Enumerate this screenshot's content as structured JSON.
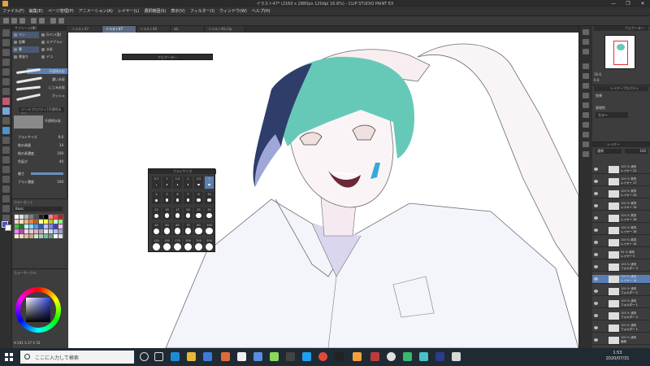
{
  "window": {
    "title": "イラスト47* (2160 x 2880px 120dpi 16.6%) - CLIP STUDIO PAINT EX",
    "minimize": "—",
    "maximize": "❐",
    "close": "✕"
  },
  "menu": [
    "ファイル(F)",
    "編集(E)",
    "ページ管理(P)",
    "アニメーション(A)",
    "レイヤー(L)",
    "選択範囲(S)",
    "表示(V)",
    "フィルター(I)",
    "ウィンドウ(W)",
    "ヘルプ(H)"
  ],
  "tabs": [
    "イラスト47",
    "イラスト47",
    "イラスト48",
    "ab",
    "イラスト46.clip"
  ],
  "subtool": {
    "header": "サブツール[筆]",
    "tabs": [
      "ペン",
      "Gペン(滑)",
      "鉛筆",
      "エアブラシ",
      "筆",
      "水彩",
      "厚塗り",
      "デコ"
    ],
    "brushes": [
      "不透明水彩",
      "濃い水彩",
      "にじみ水彩",
      "ガッシュ"
    ],
    "selected_label": "ツールプロパティ[不透明水彩]"
  },
  "toolprop": {
    "header": "不透明水彩",
    "rows": [
      {
        "label": "ブラシサイズ",
        "value": "9.0"
      },
      {
        "label": "絵の具量",
        "value": "34"
      },
      {
        "label": "絵の具濃度",
        "value": "100"
      },
      {
        "label": "色延び",
        "value": "40"
      },
      {
        "label": "硬さ",
        "value": ""
      },
      {
        "label": "ブラシ濃度",
        "value": "100"
      }
    ]
  },
  "colorset": {
    "header": "カラーセット",
    "name": "Basic"
  },
  "colorwheel": {
    "header": "カラーサークル",
    "h": "241",
    "s": "37",
    "v": "52"
  },
  "navigator_float": {
    "title": "ナビゲーター"
  },
  "brushsize": {
    "title": "ブラシサイズ",
    "sizes": [
      "0.7",
      "1",
      "1.5",
      "2",
      "2.5",
      "3",
      "4",
      "5",
      "6",
      "7",
      "8",
      "10",
      "12",
      "15",
      "17",
      "20",
      "25",
      "30",
      "40",
      "50",
      "60",
      "70",
      "80",
      "100",
      "120",
      "150",
      "170",
      "200",
      "250",
      "300"
    ],
    "selected": "3"
  },
  "rightpanels": {
    "navigator": "ナビゲーター",
    "navigator_zoom": "16.6",
    "navigator_angle": "0.0",
    "layer_property_header": "レイヤープロパティ",
    "layer_property_effect": "効果",
    "layer_property_mode_label": "表現色",
    "layer_property_mode": "カラー",
    "layer_header": "レイヤー",
    "blend": "通常",
    "opacity": "100"
  },
  "layers": [
    {
      "mode": "100 % 通常",
      "name": "レイヤー 21"
    },
    {
      "mode": "100 % 乗算",
      "name": "レイヤー 17"
    },
    {
      "mode": "100 % 乗算",
      "name": "レイヤー 20"
    },
    {
      "mode": "100 % 乗算",
      "name": "レイヤー 19"
    },
    {
      "mode": "100 % 乗算",
      "name": "レイヤー 18"
    },
    {
      "mode": "100 % 乗算",
      "name": "レイヤー 16"
    },
    {
      "mode": "100 % 乗算",
      "name": "レイヤー 15"
    },
    {
      "mode": "94 % 通常",
      "name": "レイヤー 5"
    },
    {
      "mode": "100 % 通常",
      "name": "フォルダー 3"
    },
    {
      "mode": "100 % 通常",
      "name": "レイヤー 14"
    },
    {
      "mode": "100 % 通常",
      "name": "フォルダー 2"
    },
    {
      "mode": "100 % 通常",
      "name": "フォルダー 1"
    },
    {
      "mode": "100 % 通常",
      "name": "フォルダー 4"
    },
    {
      "mode": "100 % 通常",
      "name": "フォルダー 1"
    },
    {
      "mode": "100 % 通常",
      "name": "用紙"
    }
  ],
  "taskbar": {
    "search_placeholder": "ここに入力して検索",
    "time": "1:53",
    "date": "2020/07/31"
  },
  "colors": {
    "accent_selected": "#5b7fb5",
    "hair_teal": "#66c9b8",
    "hair_navy": "#2e3d6a",
    "earring": "#39a8d8"
  }
}
